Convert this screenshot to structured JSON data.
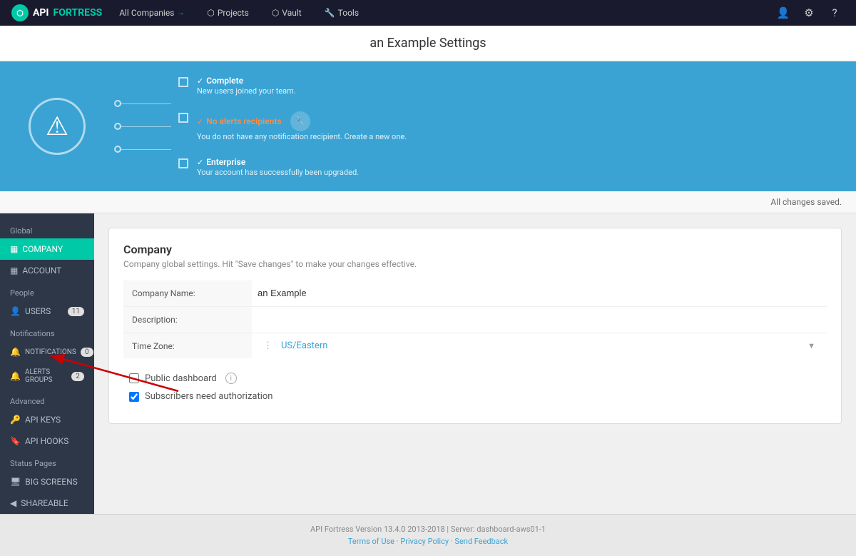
{
  "topNav": {
    "logo": {
      "api": "API",
      "fortress": "FORTRESS"
    },
    "items": [
      {
        "id": "companies",
        "label": "All Companies",
        "hasArrow": true
      },
      {
        "id": "projects",
        "label": "Projects"
      },
      {
        "id": "vault",
        "label": "Vault"
      },
      {
        "id": "tools",
        "label": "Tools"
      }
    ]
  },
  "pageTitle": "an Example Settings",
  "banner": {
    "steps": [
      {
        "id": "complete",
        "icon": "✓",
        "status": "normal",
        "title": "Complete",
        "desc": "New users joined your team."
      },
      {
        "id": "alerts",
        "icon": "✓",
        "status": "orange",
        "title": "No alerts recipients",
        "desc": "You do not have any notification recipient. Create a new one."
      },
      {
        "id": "enterprise",
        "icon": "✓",
        "status": "normal",
        "title": "Enterprise",
        "desc": "Your account has successfully been upgraded."
      }
    ]
  },
  "statusBar": {
    "text": "All changes saved."
  },
  "sidebar": {
    "sections": [
      {
        "label": "Global",
        "items": [
          {
            "id": "company",
            "label": "COMPANY",
            "icon": "▦",
            "active": true,
            "badge": null
          },
          {
            "id": "account",
            "label": "ACCOUNT",
            "icon": "▦",
            "active": false,
            "badge": null
          }
        ]
      },
      {
        "label": "People",
        "items": [
          {
            "id": "users",
            "label": "USERS",
            "icon": "👤",
            "active": false,
            "badge": "11"
          }
        ]
      },
      {
        "label": "Notifications",
        "items": [
          {
            "id": "notifications",
            "label": "NOTIFICATIONS",
            "icon": "🔔",
            "active": false,
            "badge": "0"
          },
          {
            "id": "alerts-groups",
            "label": "ALERTS GROUPS",
            "icon": "🔔",
            "active": false,
            "badge": "2"
          }
        ]
      },
      {
        "label": "Advanced",
        "items": [
          {
            "id": "api-keys",
            "label": "API KEYS",
            "icon": "🔑",
            "active": false,
            "badge": null
          },
          {
            "id": "api-hooks",
            "label": "API HOOKS",
            "icon": "🔖",
            "active": false,
            "badge": null
          }
        ]
      },
      {
        "label": "Status Pages",
        "items": [
          {
            "id": "big-screens",
            "label": "BIG SCREENS",
            "icon": "🖥",
            "active": false,
            "badge": null
          },
          {
            "id": "shareable",
            "label": "SHAREABLE",
            "icon": "◀",
            "active": false,
            "badge": null
          }
        ]
      }
    ]
  },
  "content": {
    "card": {
      "title": "Company",
      "subtitle": "Company global settings. Hit \"Save changes\" to make your changes effective.",
      "fields": [
        {
          "id": "company-name",
          "label": "Company Name:",
          "value": "an Example",
          "type": "text"
        },
        {
          "id": "description",
          "label": "Description:",
          "value": "",
          "type": "text"
        },
        {
          "id": "timezone",
          "label": "Time Zone:",
          "value": "US/Eastern",
          "type": "select",
          "hasInfo": true
        }
      ],
      "checkboxes": [
        {
          "id": "public-dashboard",
          "label": "Public dashboard",
          "checked": false,
          "hasInfo": true
        },
        {
          "id": "subscribers-auth",
          "label": "Subscribers need authorization",
          "checked": true
        }
      ]
    }
  },
  "footer": {
    "text": "API Fortress Version 13.4.0 2013-2018 | Server: dashboard-aws01-1",
    "links": [
      {
        "id": "terms",
        "label": "Terms of Use"
      },
      {
        "id": "privacy",
        "label": "Privacy Policy"
      },
      {
        "id": "feedback",
        "label": "Send Feedback"
      }
    ]
  }
}
